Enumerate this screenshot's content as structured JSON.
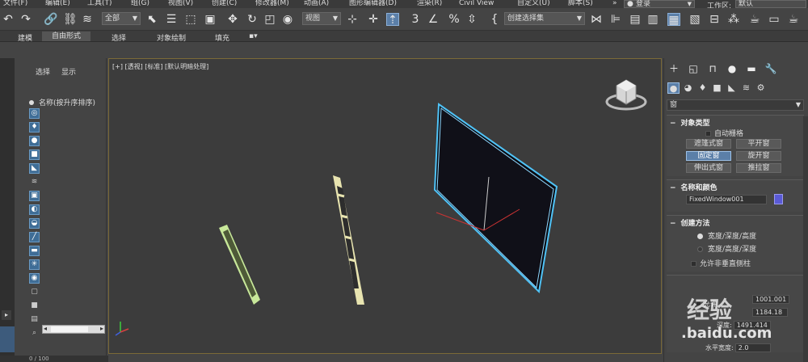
{
  "menu": {
    "items": [
      "文件(F)",
      "编辑(E)",
      "工具(T)",
      "组(G)",
      "视图(V)",
      "创建(C)",
      "修改器(M)",
      "动画(A)",
      "图形编辑器(D)",
      "渲染(R)",
      "Civil View",
      "自定义(U)",
      "脚本(S)"
    ],
    "login": "登录",
    "workspace_label": "工作区:",
    "workspace_value": "默认"
  },
  "toolbar": {
    "selection_filter": "全部",
    "reference_coord": "视图",
    "named_selection": "创建选择集"
  },
  "ribbon": {
    "tabs": [
      "建模",
      "自由形式",
      "选择",
      "对象绘制",
      "填充"
    ]
  },
  "scene_explorer": {
    "tabs": [
      "选择",
      "显示"
    ],
    "column_header": "名称(按升序排序)"
  },
  "timeline": {
    "frame": "0 / 100"
  },
  "viewport": {
    "label": "[+] [透视] [标准] [默认明暗处理]"
  },
  "command_panel": {
    "category_dropdown": "窗",
    "object_type": {
      "title": "对象类型",
      "autogrid": "自动栅格",
      "buttons": [
        "遮篷式窗",
        "平开窗",
        "固定窗",
        "旋开窗",
        "伸出式窗",
        "推拉窗"
      ],
      "selected": "固定窗"
    },
    "name_color": {
      "title": "名称和颜色",
      "name": "FixedWindow001",
      "color": "#5a5ad6"
    },
    "creation_method": {
      "title": "创建方法",
      "options": [
        "宽度/深度/高度",
        "宽度/高度/深度"
      ],
      "allow_non_vertical": "允许非垂直侧柱"
    },
    "parameters": {
      "height_value": "1001.001",
      "width_value": "1184.18",
      "depth_label": "深度:",
      "depth_value": "1491.414",
      "h_width_label": "水平宽度:",
      "h_width_value": "2.0",
      "partial_label": "允许"
    }
  },
  "watermark": {
    "line1": "经验",
    "line2": ".baidu.com"
  },
  "colors": {
    "accent": "#5b7fa8",
    "viewport_border": "#7b6a38",
    "selected_window": "#4fc3f7",
    "window_green": "#b8e08a",
    "window_cream": "#e8e4b0"
  }
}
